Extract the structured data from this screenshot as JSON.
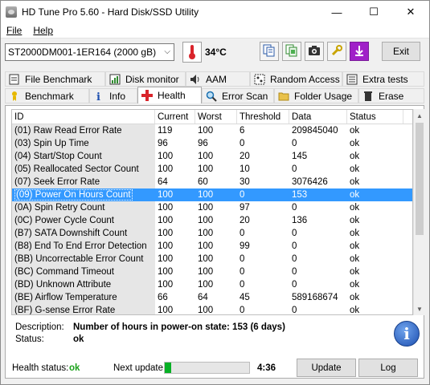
{
  "window": {
    "title": "HD Tune Pro 5.60 - Hard Disk/SSD Utility",
    "minimize": "—",
    "maximize": "☐",
    "close": "✕"
  },
  "menu": {
    "file": "File",
    "help": "Help"
  },
  "toolbar": {
    "drive": "ST2000DM001-1ER164 (2000 gB)",
    "temperature": "34°C",
    "exit": "Exit"
  },
  "tabs_top": [
    "File Benchmark",
    "Disk monitor",
    "AAM",
    "Random Access",
    "Extra tests"
  ],
  "tabs_bottom": [
    "Benchmark",
    "Info",
    "Health",
    "Error Scan",
    "Folder Usage",
    "Erase"
  ],
  "grid": {
    "headers": [
      "ID",
      "Current",
      "Worst",
      "Threshold",
      "Data",
      "Status"
    ],
    "rows": [
      [
        "(01) Raw Read Error Rate",
        "119",
        "100",
        "6",
        "209845040",
        "ok"
      ],
      [
        "(03) Spin Up Time",
        "96",
        "96",
        "0",
        "0",
        "ok"
      ],
      [
        "(04) Start/Stop Count",
        "100",
        "100",
        "20",
        "145",
        "ok"
      ],
      [
        "(05) Reallocated Sector Count",
        "100",
        "100",
        "10",
        "0",
        "ok"
      ],
      [
        "(07) Seek Error Rate",
        "64",
        "60",
        "30",
        "3076426",
        "ok"
      ],
      [
        "(09) Power On Hours Count",
        "100",
        "100",
        "0",
        "153",
        "ok"
      ],
      [
        "(0A) Spin Retry Count",
        "100",
        "100",
        "97",
        "0",
        "ok"
      ],
      [
        "(0C) Power Cycle Count",
        "100",
        "100",
        "20",
        "136",
        "ok"
      ],
      [
        "(B7) SATA Downshift Count",
        "100",
        "100",
        "0",
        "0",
        "ok"
      ],
      [
        "(B8) End To End Error Detection",
        "100",
        "100",
        "99",
        "0",
        "ok"
      ],
      [
        "(BB) Uncorrectable Error Count",
        "100",
        "100",
        "0",
        "0",
        "ok"
      ],
      [
        "(BC) Command Timeout",
        "100",
        "100",
        "0",
        "0",
        "ok"
      ],
      [
        "(BD) Unknown Attribute",
        "100",
        "100",
        "0",
        "0",
        "ok"
      ],
      [
        "(BE) Airflow Temperature",
        "66",
        "64",
        "45",
        "589168674",
        "ok"
      ],
      [
        "(BF) G-sense Error Rate",
        "100",
        "100",
        "0",
        "0",
        "ok"
      ]
    ],
    "selected_index": 5
  },
  "details": {
    "description_label": "Description:",
    "description": "Number of hours in power-on state: 153 (6 days)",
    "status_label": "Status:",
    "status": "ok"
  },
  "footer": {
    "health_label": "Health status:",
    "health_value": "ok",
    "next_update_label": "Next update:",
    "progress_fraction": 0.08,
    "next_update_time": "4:36",
    "update_button": "Update",
    "log_button": "Log"
  },
  "colors": {
    "selection": "#3399ff",
    "health_ok": "#1aa11a",
    "progress": "#06b025",
    "thermo": "#d9242b",
    "health_tab": "#d9242b",
    "erase": "#333333"
  }
}
